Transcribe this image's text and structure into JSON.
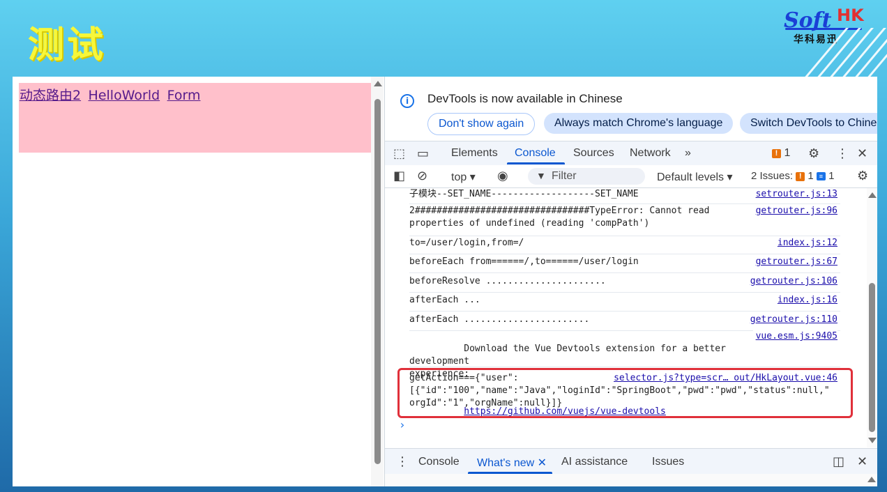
{
  "slide": {
    "title": "测试",
    "logo_soft": "Soft",
    "logo_hk": "HK",
    "logo_cn": "华科易迅"
  },
  "app": {
    "links": [
      "动态路由2",
      "HelloWorld",
      "Form"
    ]
  },
  "devtools": {
    "infobar": {
      "message": "DevTools is now available in Chinese",
      "btn_dont_show": "Don't show again",
      "btn_match": "Always match Chrome's language",
      "btn_switch": "Switch DevTools to Chinese"
    },
    "tabs": {
      "elements": "Elements",
      "console": "Console",
      "sources": "Sources",
      "network": "Network",
      "more": "»",
      "issues_count": "1"
    },
    "toolbar": {
      "context": "top",
      "filter_placeholder": "Filter",
      "levels": "Default levels",
      "issues_label": "2 Issues:",
      "issues_warn": "1",
      "issues_info": "1"
    },
    "logs": [
      {
        "msg": "子模块--SET_NAME-------------------SET_NAME",
        "src": "setrouter.js:13"
      },
      {
        "msg": "2################################TypeError: Cannot read\nproperties of undefined (reading 'compPath')",
        "src": "getrouter.js:96"
      },
      {
        "msg": "to=/user/login,from=/",
        "src": "index.js:12"
      },
      {
        "msg": "beforeEach from======/,to======/user/login",
        "src": "getrouter.js:67"
      },
      {
        "msg": "beforeResolve ......................",
        "src": "getrouter.js:106"
      },
      {
        "msg": "afterEach ...",
        "src": "index.js:16"
      },
      {
        "msg": "afterEach .......................",
        "src": "getrouter.js:110"
      },
      {
        "msg": "Download the Vue Devtools extension for a better development\nexperience:",
        "link": "https://github.com/vuejs/vue-devtools",
        "src": "vue.esm.js:9405"
      },
      {
        "msg": "getAction==={\"user\":\n[{\"id\":\"100\",\"name\":\"Java\",\"loginId\":\"SpringBoot\",\"pwd\":\"pwd\",\"status\":null,\"\norgId\":\"1\",\"orgName\":null}]}",
        "src": "selector.js?type=scr… out/HkLayout.vue:46"
      }
    ],
    "drawer": {
      "console": "Console",
      "whats_new": "What's new",
      "ai": "AI assistance",
      "issues": "Issues"
    }
  }
}
